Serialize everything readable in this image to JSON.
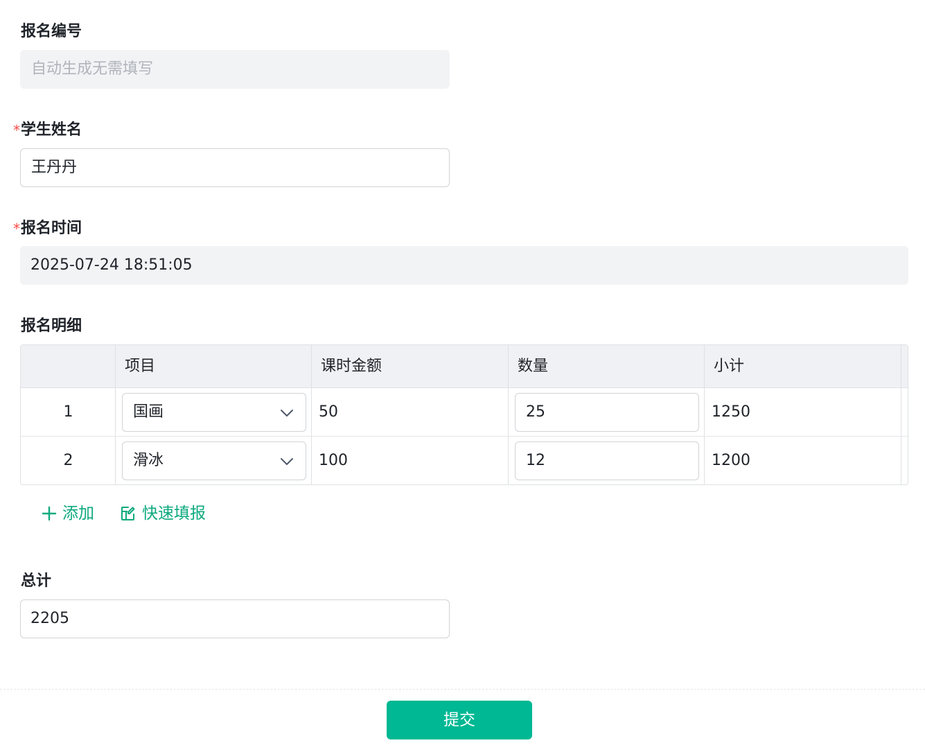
{
  "form": {
    "reg_no": {
      "label": "报名编号",
      "placeholder": "自动生成无需填写"
    },
    "student_name": {
      "label": "学生姓名",
      "required_mark": "*",
      "value": "王丹丹"
    },
    "reg_time": {
      "label": "报名时间",
      "required_mark": "*",
      "value": "2025-07-24 18:51:05"
    },
    "details": {
      "label": "报名明细",
      "columns": [
        "",
        "项目",
        "课时金额",
        "数量",
        "小计"
      ],
      "rows": [
        {
          "index": "1",
          "item": "国画",
          "price": "50",
          "qty": "25",
          "subtotal": "1250"
        },
        {
          "index": "2",
          "item": "滑冰",
          "price": "100",
          "qty": "12",
          "subtotal": "1200"
        }
      ],
      "actions": {
        "add": "添加",
        "quick_fill": "快速填报"
      }
    },
    "total": {
      "label": "总计",
      "value": "2205"
    },
    "submit_label": "提交"
  },
  "colors": {
    "accent": "#00b893",
    "link": "#0ea97e",
    "required": "#f54a45"
  },
  "icons": {
    "add": "plus-icon",
    "quick_fill": "edit-table-icon",
    "select": "chevron-down-icon"
  }
}
